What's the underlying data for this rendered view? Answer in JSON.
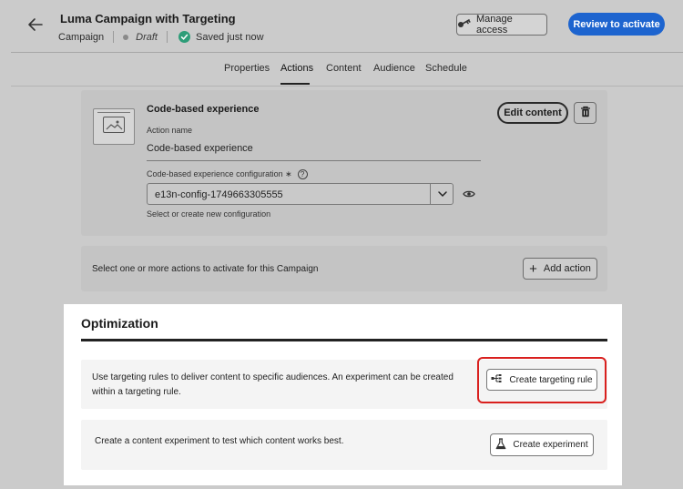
{
  "header": {
    "title": "Luma Campaign with Targeting",
    "type": "Campaign",
    "status": "Draft",
    "save_status": "Saved just now",
    "manage_access_label": "Manage access",
    "review_label": "Review to activate"
  },
  "tabs": [
    {
      "label": "Properties",
      "active": false
    },
    {
      "label": "Actions",
      "active": true
    },
    {
      "label": "Content",
      "active": false
    },
    {
      "label": "Audience",
      "active": false
    },
    {
      "label": "Schedule",
      "active": false
    }
  ],
  "action_card": {
    "title": "Code-based experience",
    "edit_label": "Edit content",
    "action_name_label": "Action name",
    "action_name_value": "Code-based experience",
    "config_label": "Code-based experience configuration ∗",
    "config_value": "e13n-config-1749663305555",
    "config_help": "Select or create new configuration"
  },
  "add_action_card": {
    "text": "Select one or more actions to activate for this Campaign",
    "button_label": "Add action"
  },
  "optimization": {
    "title": "Optimization",
    "targeting_text": "Use targeting rules to deliver content to specific audiences. An experiment can be created within a targeting rule.",
    "targeting_button": "Create targeting rule",
    "experiment_text": "Create a content experiment to test which content works best.",
    "experiment_button": "Create experiment"
  },
  "colors": {
    "primary": "#1d64cf",
    "success": "#2d9d78",
    "highlight": "#d9201e"
  }
}
